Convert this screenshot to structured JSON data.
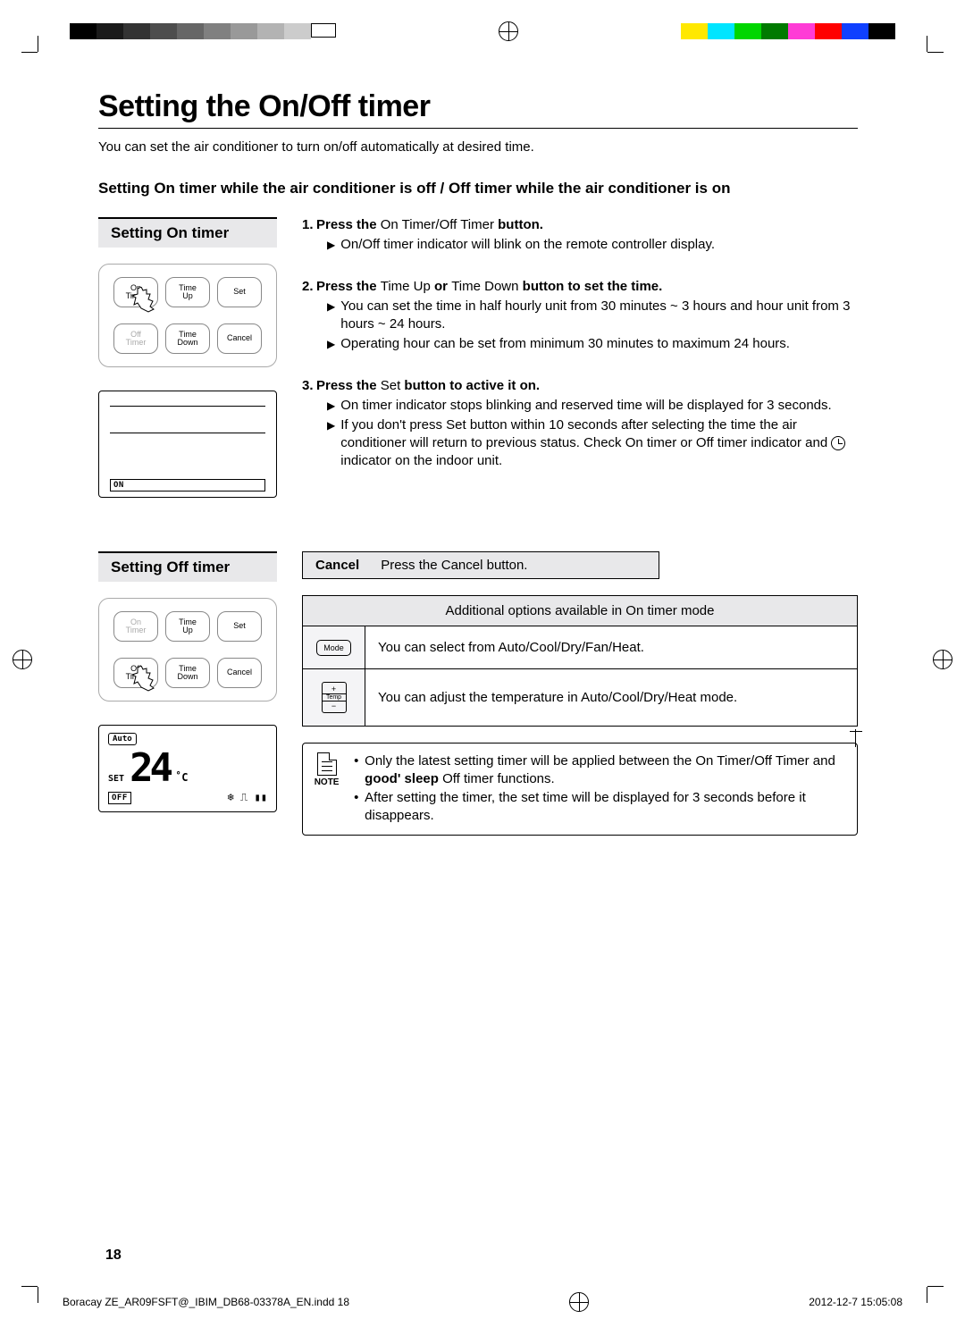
{
  "title": "Setting the On/Off timer",
  "intro": "You can set the air conditioner to turn on/off automatically at desired time.",
  "subheading": "Setting On timer while the air conditioner is off / Off timer while the air conditioner is on",
  "page_number": "18",
  "footer_left": "Boracay ZE_AR09FSFT@_IBIM_DB68-03378A_EN.indd   18",
  "footer_right": "2012-12-7   15:05:08",
  "on_section": {
    "heading": "Setting On timer",
    "buttons": {
      "on_timer": "On\nTimer",
      "time_up": "Time\nUp",
      "set": "Set",
      "off_timer": "Off\nTimer",
      "time_down": "Time\nDown",
      "cancel": "Cancel"
    },
    "display_badge": "ON",
    "steps": [
      {
        "n": "1.",
        "head_bold1": "Press the ",
        "head_mid": "On Timer/Off Timer",
        "head_bold2": " button.",
        "bullets": [
          "On/Off timer indicator will blink on the remote controller display."
        ]
      },
      {
        "n": "2.",
        "head_bold1": "Press the ",
        "head_mid": "Time Up",
        "head_or": " or ",
        "head_mid2": "Time Down",
        "head_bold2": " button to set the time.",
        "bullets": [
          "You can set the time in half hourly unit from 30 minutes ~ 3 hours and hour unit from 3 hours ~ 24 hours.",
          "Operating hour can be set from minimum 30 minutes to maximum 24 hours."
        ]
      },
      {
        "n": "3.",
        "head_bold1": "Press the ",
        "head_mid": "Set",
        "head_bold2": " button to active it on.",
        "bullets": [
          "On timer indicator stops blinking and reserved time will be displayed for 3 seconds.",
          "If you don't press Set button within 10 seconds after selecting the time the air conditioner will return to previous status. Check On timer or Off timer indicator and [clock] indicator on the indoor unit."
        ]
      }
    ]
  },
  "off_section": {
    "heading": "Setting Off timer",
    "buttons": {
      "on_timer": "On\nTimer",
      "time_up": "Time\nUp",
      "set": "Set",
      "off_timer": "Off\nTimer",
      "time_down": "Time\nDown",
      "cancel": "Cancel"
    },
    "display": {
      "auto": "Auto",
      "set": "SET",
      "temp": "24",
      "unit": "˚C",
      "off": "OFF"
    },
    "cancel": {
      "label": "Cancel",
      "text_pre": "Press the ",
      "text_mid": "Cancel",
      "text_post": " button."
    },
    "options": {
      "header": "Additional options available in On timer mode",
      "mode_chip": "Mode",
      "mode_text": "You can select from Auto/Cool/Dry/Fan/Heat.",
      "temp_chip_plus": "+",
      "temp_chip_label": "Temp",
      "temp_chip_minus": "−",
      "temp_text": "You can adjust the temperature in Auto/Cool/Dry/Heat mode."
    },
    "note": {
      "label": "NOTE",
      "items": [
        "Only the latest setting timer will be applied between the On Timer/Off Timer and good' sleep Off timer functions.",
        "After setting the timer, the set time will be displayed for 3 seconds before it disappears."
      ],
      "good_sleep": "good' sleep"
    }
  },
  "gray_swatches": [
    "#000000",
    "#1a1a1a",
    "#333333",
    "#4d4d4d",
    "#666666",
    "#808080",
    "#999999",
    "#b3b3b3",
    "#cccccc",
    "#ffffff"
  ],
  "color_swatches": [
    "#ffff00",
    "#00ffff",
    "#00ff00",
    "#009000",
    "#ff00ff",
    "#ff0000",
    "#0000ff",
    "#000000"
  ]
}
